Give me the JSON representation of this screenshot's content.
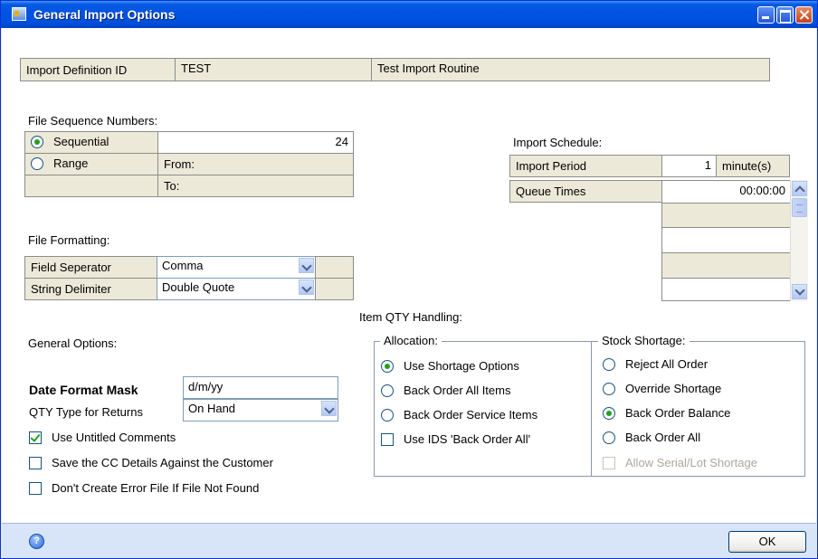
{
  "window": {
    "title": "General Import Options"
  },
  "definition": {
    "label": "Import Definition ID",
    "id": "TEST",
    "description": "Test Import Routine"
  },
  "file_sequence": {
    "heading": "File Sequence Numbers:",
    "sequential_label": "Sequential",
    "sequential_value": "24",
    "range_label": "Range",
    "from_label": "From:",
    "to_label": "To:",
    "selected": "Sequential"
  },
  "import_schedule": {
    "heading": "Import Schedule:",
    "period_label": "Import Period",
    "period_value": "1",
    "period_unit": "minute(s)",
    "queue_label": "Queue Times",
    "queue_values": [
      "00:00:00",
      "",
      "",
      "",
      ""
    ]
  },
  "file_formatting": {
    "heading": "File Formatting:",
    "field_sep_label": "Field Seperator",
    "field_sep_value": "Comma",
    "string_delim_label": "String Delimiter",
    "string_delim_value": "Double Quote"
  },
  "general_options": {
    "heading": "General Options:",
    "date_mask_label": "Date Format Mask",
    "date_mask_value": "d/m/yy",
    "qty_type_label": "QTY Type for Returns",
    "qty_type_value": "On Hand",
    "checkboxes": [
      {
        "label": "Use Untitled Comments",
        "checked": true
      },
      {
        "label": "Save the CC Details Against the Customer",
        "checked": false
      },
      {
        "label": "Don't Create Error File If File Not Found",
        "checked": false
      }
    ]
  },
  "item_qty": {
    "heading": "Item QTY Handling:",
    "allocation": {
      "legend": "Allocation:",
      "options": [
        "Use Shortage Options",
        "Back Order All Items",
        "Back Order Service Items"
      ],
      "selected": "Use Shortage Options",
      "ids_checkbox_label": "Use IDS 'Back Order All'"
    },
    "stock_shortage": {
      "legend": "Stock Shortage:",
      "options": [
        "Reject All Order",
        "Override Shortage",
        "Back Order Balance",
        "Back Order All"
      ],
      "selected": "Back Order Balance",
      "serial_lot_label": "Allow Serial/Lot Shortage"
    }
  },
  "footer": {
    "help_icon_glyph": "?",
    "ok_label": "OK"
  },
  "colors": {
    "titlebar": "#0054e3",
    "footer": "#d8e4f8",
    "radio_dot": "#21a121"
  }
}
